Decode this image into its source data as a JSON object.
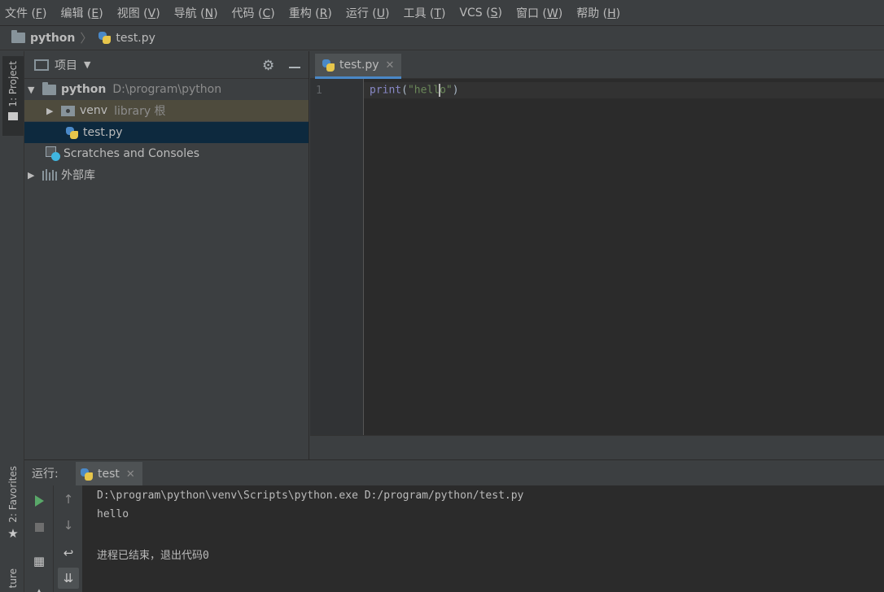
{
  "menubar": {
    "items": [
      {
        "label": "文件 (",
        "mnemonic": "F",
        "tail": ")"
      },
      {
        "label": "编辑 (",
        "mnemonic": "E",
        "tail": ")"
      },
      {
        "label": "视图 (",
        "mnemonic": "V",
        "tail": ")"
      },
      {
        "label": "导航 (",
        "mnemonic": "N",
        "tail": ")"
      },
      {
        "label": "代码 (",
        "mnemonic": "C",
        "tail": ")"
      },
      {
        "label": "重构 (",
        "mnemonic": "R",
        "tail": ")"
      },
      {
        "label": "运行 (",
        "mnemonic": "U",
        "tail": ")"
      },
      {
        "label": "工具 (",
        "mnemonic": "T",
        "tail": ")"
      },
      {
        "label": "VCS (",
        "mnemonic": "S",
        "tail": ")"
      },
      {
        "label": "窗口 (",
        "mnemonic": "W",
        "tail": ")"
      },
      {
        "label": "帮助 (",
        "mnemonic": "H",
        "tail": ")"
      }
    ]
  },
  "navbar": {
    "project": "python",
    "separator": "〉",
    "file": "test.py"
  },
  "left_strip": {
    "project_tab": "1: Project",
    "favorites_tab": "2: Favorites",
    "structure_tab": "ture"
  },
  "project_panel": {
    "title": "项目",
    "caret": "▼",
    "gear_icon": "⚙",
    "tree": [
      {
        "expander": "▼",
        "name": "python",
        "hint": "D:\\program\\python"
      },
      {
        "expander": "▶",
        "name": "venv",
        "hint": "library 根"
      },
      {
        "expander": "",
        "name": "test.py",
        "hint": ""
      },
      {
        "expander": "",
        "name": "Scratches and Consoles",
        "hint": ""
      },
      {
        "expander": "▶",
        "name": "外部库",
        "hint": ""
      }
    ]
  },
  "editor": {
    "tab_label": "test.py",
    "close_glyph": "✕",
    "line_number": "1",
    "code": {
      "fn": "print",
      "open": "(",
      "str_before_caret": "\"hell",
      "str_after_caret": "o\"",
      "close": ")"
    }
  },
  "run_panel": {
    "label": "运行:",
    "tab_label": "test",
    "close_glyph": "✕",
    "toolbar": {
      "up_arrow": "↑",
      "down_arrow": "↓",
      "wrap_icon": "↩",
      "scroll_icon": "⇊",
      "layout_icon": "▦"
    },
    "console_lines": [
      "D:\\program\\python\\venv\\Scripts\\python.exe D:/program/python/test.py",
      "hello",
      "",
      "进程已结束，退出代码0"
    ]
  },
  "colors": {
    "background": "#3c3f41",
    "editor_bg": "#2b2b2b",
    "selection": "#0d293e",
    "accent_tab": "#4a88c7",
    "string": "#6a8759",
    "builtin": "#8888c6",
    "run_green": "#59a869"
  }
}
